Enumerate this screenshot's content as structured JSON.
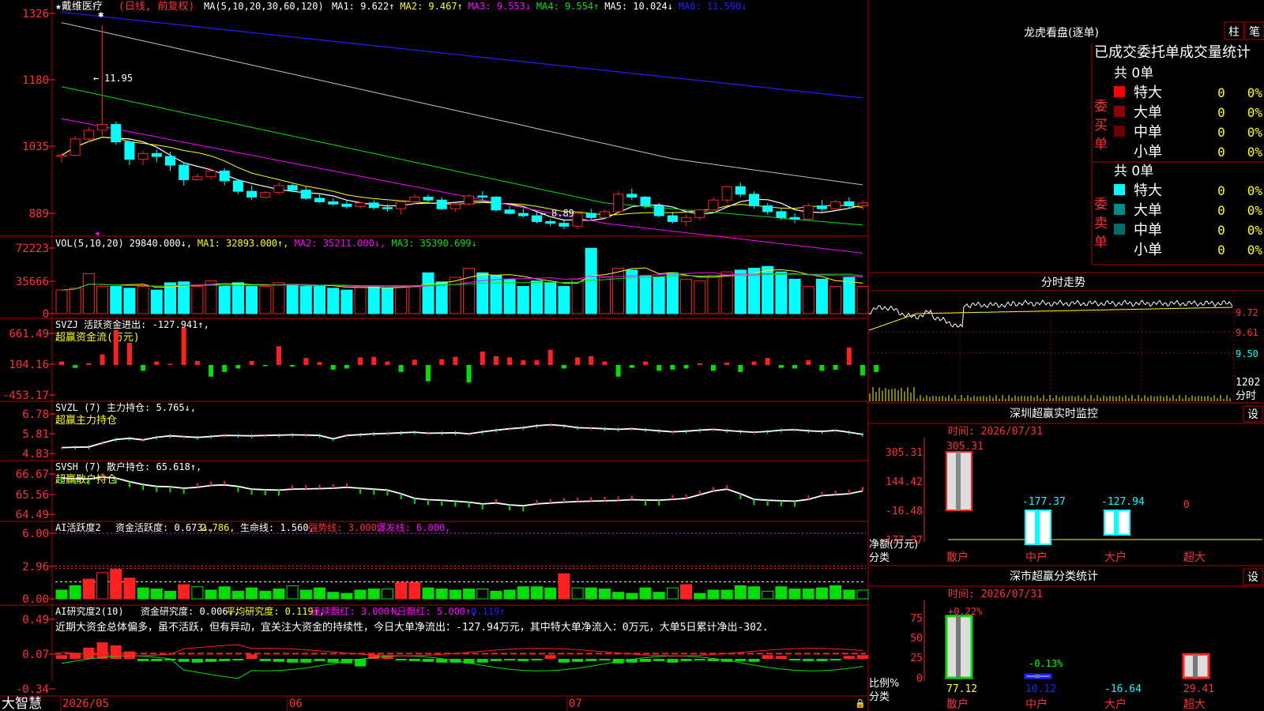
{
  "colors": {
    "up": "#ff2020",
    "down": "#00ffff",
    "green": "#00e000",
    "border": "#b00000",
    "ma1": "#ffffff",
    "ma2": "#ffff00",
    "ma3": "#ff00ff",
    "ma4": "#00e000",
    "ma5": "#c0c0c0",
    "ma6": "#2020ff",
    "text_white": "#ffffff",
    "text_yellow": "#ffff00",
    "text_red": "#ff3030",
    "text_cyan": "#00ffff",
    "text_green": "#00ff00",
    "text_magenta": "#ff00ff"
  },
  "app": {
    "brand": "大智慧"
  },
  "price_panel": {
    "title": "★戴维医疗",
    "mode": "(日线, 前复权)",
    "ma_params": "MA(5,10,20,30,60,120)",
    "ma_values": [
      {
        "text": "MA1: 9.622↑",
        "color": "#ffffff"
      },
      {
        "text": "MA2: 9.467↑",
        "color": "#ffff00"
      },
      {
        "text": "MA3: 9.553↓",
        "color": "#ff00ff"
      },
      {
        "text": "MA4: 9.554↑",
        "color": "#00e000"
      },
      {
        "text": "MA5: 10.024↓",
        "color": "#ffffff"
      },
      {
        "text": "MA6: 11.590↓",
        "color": "#2020ff"
      }
    ],
    "y_ticks": [
      "1326",
      "1180",
      "1035",
      "889"
    ],
    "high_marker": "11.95",
    "low_marker": "8.89"
  },
  "vol_panel": {
    "label": "VOL(5,10,20)",
    "values": [
      {
        "text": "29840.000↓,",
        "color": "#ffffff"
      },
      {
        "text": "MA1: 32893.000↑,",
        "color": "#ffff00"
      },
      {
        "text": "MA2: 35211.000↓,",
        "color": "#ff00ff"
      },
      {
        "text": "MA3: 35390.699↓",
        "color": "#00e000"
      }
    ],
    "y_ticks": [
      "72223",
      "35666",
      "0"
    ]
  },
  "svzj_panel": {
    "label": "SVZJ  活跃资金进出: -127.941↑,",
    "sub": "超赢资金流(万元)",
    "y_ticks": [
      "661.49",
      "104.16",
      "-453.17"
    ]
  },
  "svzl_panel": {
    "label": "SVZL  (7) 主力持仓: 5.765↓,",
    "sub": "超赢主力持仓",
    "y_ticks": [
      "6.78",
      "5.81",
      "4.83"
    ]
  },
  "svsh_panel": {
    "label": "SVSH  (7) 散户持仓: 65.618↑,",
    "sub": "超赢散户持仓",
    "y_ticks": [
      "66.67",
      "65.56",
      "64.49"
    ]
  },
  "ai_active_panel": {
    "label": "AI活跃度2",
    "values": [
      {
        "text": "资金活跃度: 0.673↓,",
        "color": "#ffffff"
      },
      {
        "text": "2.786,",
        "color": "#ffff00"
      },
      {
        "text": "生命线: 1.560,",
        "color": "#ffffff"
      },
      {
        "text": "强势线: 3.000,",
        "color": "#ff3030"
      },
      {
        "text": "爆发线: 6.000,",
        "color": "#ff00ff"
      }
    ],
    "y_ticks": [
      "6.00",
      "2.96",
      "0.00"
    ]
  },
  "ai_research_panel": {
    "label": "AI研究度2(10)",
    "values": [
      {
        "text": "资金研究度: 0.006↓,",
        "color": "#ffffff"
      },
      {
        "text": "平均研究度: 0.119↑,",
        "color": "#ffff00"
      },
      {
        "text": "连续飘红: 3.000↑,",
        "color": "#ff00ff"
      },
      {
        "text": "N日飘红: 5.000↑,",
        "color": "#ff00ff"
      },
      {
        "text": "0.119↑",
        "color": "#2020ff"
      }
    ],
    "comment": "近期大资金总体偏多，虽不活跃，但有异动，宜关注大资金的持续性，今日大单净流出：-127.94万元，其中特大单净流入：0万元，大单5日累计净出-302.",
    "y_ticks": [
      "0.49",
      "0.07",
      "-0.34"
    ]
  },
  "x_axis": {
    "labels": [
      "2026/05",
      "06",
      "07"
    ]
  },
  "dragon_tiger": {
    "title": "龙虎看盘(逐单)",
    "tabs": [
      "柱",
      "笔"
    ],
    "heading": "已成交委托单成交量统计",
    "buy": {
      "side_label": "委买单",
      "total": "共 0单",
      "rows": [
        {
          "label": "特大",
          "value": "0",
          "pct": "0%",
          "color": "#ff0000"
        },
        {
          "label": "大单",
          "value": "0",
          "pct": "0%",
          "color": "#8b0000"
        },
        {
          "label": "中单",
          "value": "0",
          "pct": "0%",
          "color": "#6b0000"
        },
        {
          "label": "小单",
          "value": "0",
          "pct": "0%",
          "color": "#000000"
        }
      ]
    },
    "sell": {
      "side_label": "委卖单",
      "total": "共 0单",
      "rows": [
        {
          "label": "特大",
          "value": "0",
          "pct": "0%",
          "color": "#00ffff"
        },
        {
          "label": "大单",
          "value": "0",
          "pct": "0%",
          "color": "#008b8b"
        },
        {
          "label": "中单",
          "value": "0",
          "pct": "0%",
          "color": "#006b6b"
        },
        {
          "label": "小单",
          "value": "0",
          "pct": "0%",
          "color": "#000000"
        }
      ]
    }
  },
  "intraday": {
    "title": "分时走势",
    "y_ticks": [
      "9.72",
      "9.61",
      "9.50"
    ],
    "vol_tick": "1202",
    "vol_unit": "分时"
  },
  "monitor": {
    "title": "深圳超赢实时监控",
    "settings": "设",
    "time": "时间: 2026/07/31",
    "y_ticks": [
      "305.31",
      "144.42",
      "-16.48",
      "-177.37"
    ],
    "unit_label": "净额(万元)",
    "cat_label": "分类",
    "categories": [
      "散户",
      "中户",
      "大户",
      "超大"
    ],
    "values": [
      "305.31",
      "-177.37",
      "-127.94",
      "0"
    ]
  },
  "classify": {
    "title": "深市超赢分类统计",
    "settings": "设",
    "time": "时间: 2026/07/31",
    "y_ticks": [
      "75",
      "50",
      "25",
      "0"
    ],
    "unit_label": "比例%",
    "cat_label": "分类",
    "categories": [
      "散户",
      "中户",
      "大户",
      "超大"
    ],
    "values": [
      "77.12",
      "10.12",
      "-16.64",
      "29.41"
    ],
    "top_labels": [
      "+0.22%",
      "-0.13%"
    ]
  },
  "chart_data": [
    {
      "type": "candlestick",
      "title": "戴维医疗 (日线, 前复权)",
      "note": "candle OHLC estimated from axis ticks 889/1035/1180/1326",
      "candles": [
        [
          9.7,
          9.75,
          9.6,
          9.72
        ],
        [
          9.72,
          10.05,
          9.7,
          10.0
        ],
        [
          10.0,
          10.2,
          9.95,
          10.15
        ],
        [
          10.15,
          11.95,
          10.05,
          10.25
        ],
        [
          10.25,
          10.3,
          9.9,
          9.95
        ],
        [
          9.95,
          10.0,
          9.55,
          9.65
        ],
        [
          9.65,
          9.8,
          9.55,
          9.75
        ],
        [
          9.75,
          9.82,
          9.6,
          9.7
        ],
        [
          9.7,
          9.78,
          9.45,
          9.55
        ],
        [
          9.55,
          9.6,
          9.2,
          9.3
        ],
        [
          9.3,
          9.4,
          9.28,
          9.35
        ],
        [
          9.35,
          9.5,
          9.3,
          9.45
        ],
        [
          9.45,
          9.5,
          9.2,
          9.28
        ],
        [
          9.28,
          9.3,
          9.05,
          9.1
        ],
        [
          9.1,
          9.2,
          8.95,
          9.0
        ],
        [
          9.0,
          9.1,
          8.98,
          9.08
        ],
        [
          9.08,
          9.25,
          9.05,
          9.2
        ],
        [
          9.2,
          9.25,
          9.1,
          9.12
        ],
        [
          9.12,
          9.18,
          8.95,
          8.98
        ],
        [
          8.98,
          9.05,
          8.9,
          8.92
        ],
        [
          8.92,
          8.98,
          8.85,
          8.88
        ],
        [
          8.88,
          8.95,
          8.8,
          8.84
        ],
        [
          8.84,
          8.92,
          8.8,
          8.9
        ],
        [
          8.9,
          8.95,
          8.78,
          8.82
        ],
        [
          8.82,
          8.88,
          8.75,
          8.8
        ],
        [
          8.8,
          8.95,
          8.7,
          8.92
        ],
        [
          8.92,
          9.05,
          8.88,
          9.0
        ],
        [
          9.0,
          9.05,
          8.9,
          8.95
        ],
        [
          8.95,
          9.0,
          8.78,
          8.8
        ],
        [
          8.8,
          8.9,
          8.75,
          8.88
        ],
        [
          8.88,
          9.05,
          8.85,
          9.02
        ],
        [
          9.02,
          9.1,
          8.95,
          9.0
        ],
        [
          9.0,
          9.02,
          8.75,
          8.78
        ],
        [
          8.78,
          8.85,
          8.7,
          8.72
        ],
        [
          8.72,
          8.8,
          8.65,
          8.68
        ],
        [
          8.68,
          8.75,
          8.55,
          8.58
        ],
        [
          8.58,
          8.62,
          8.5,
          8.55
        ],
        [
          8.55,
          8.6,
          8.45,
          8.5
        ],
        [
          8.5,
          8.75,
          8.45,
          8.72
        ],
        [
          8.72,
          8.8,
          8.6,
          8.65
        ],
        [
          8.65,
          8.78,
          8.62,
          8.75
        ],
        [
          8.75,
          9.1,
          8.72,
          9.05
        ],
        [
          9.05,
          9.15,
          8.95,
          9.0
        ],
        [
          9.0,
          9.02,
          8.8,
          8.85
        ],
        [
          8.85,
          8.9,
          8.65,
          8.68
        ],
        [
          8.68,
          8.75,
          8.55,
          8.58
        ],
        [
          8.58,
          8.7,
          8.5,
          8.65
        ],
        [
          8.65,
          8.8,
          8.6,
          8.78
        ],
        [
          8.78,
          9.0,
          8.75,
          8.95
        ],
        [
          8.95,
          9.2,
          8.9,
          9.18
        ],
        [
          9.18,
          9.25,
          9.0,
          9.05
        ],
        [
          9.05,
          9.1,
          8.8,
          8.85
        ],
        [
          8.85,
          8.9,
          8.7,
          8.75
        ],
        [
          8.75,
          8.82,
          8.6,
          8.65
        ],
        [
          8.65,
          8.72,
          8.55,
          8.62
        ],
        [
          8.62,
          8.9,
          8.6,
          8.85
        ],
        [
          8.85,
          8.95,
          8.75,
          8.8
        ],
        [
          8.8,
          8.95,
          8.78,
          8.92
        ],
        [
          8.92,
          9.0,
          8.8,
          8.85
        ],
        [
          8.85,
          8.95,
          8.78,
          8.9
        ]
      ]
    },
    {
      "type": "bar",
      "title": "VOL(5,10,20)",
      "values": [
        26000,
        28000,
        44000,
        30000,
        30000,
        28000,
        30000,
        26000,
        34000,
        35000,
        30000,
        36000,
        30000,
        34000,
        30000,
        30000,
        34000,
        32000,
        30000,
        30000,
        28000,
        26000,
        30000,
        30000,
        28000,
        30000,
        30000,
        45000,
        35000,
        40000,
        50000,
        45000,
        42000,
        38000,
        30000,
        36000,
        34000,
        30000,
        38000,
        72000,
        40000,
        50000,
        48000,
        42000,
        40000,
        45000,
        38000,
        36000,
        42000,
        46000,
        48000,
        50000,
        52000,
        46000,
        38000,
        30000,
        38000,
        30000,
        40000,
        30000
      ]
    },
    {
      "type": "bar",
      "title": "SVZJ 活跃资金进出",
      "values": [
        60,
        -50,
        30,
        180,
        600,
        380,
        -100,
        60,
        20,
        640,
        70,
        -200,
        -120,
        -60,
        70,
        -20,
        320,
        -30,
        120,
        50,
        -80,
        -60,
        130,
        140,
        60,
        -120,
        90,
        -280,
        100,
        140,
        -300,
        230,
        150,
        130,
        80,
        80,
        260,
        -60,
        130,
        150,
        60,
        -200,
        -50,
        60,
        -100,
        -80,
        -60,
        30,
        -100,
        40,
        -120,
        60,
        120,
        -50,
        -60,
        80,
        -100,
        -80,
        300,
        -180,
        -120
      ]
    },
    {
      "type": "line",
      "title": "SVZL 主力持仓",
      "values": [
        5.12,
        5.14,
        5.15,
        5.35,
        5.52,
        5.58,
        5.5,
        5.63,
        5.7,
        5.66,
        5.62,
        5.67,
        5.72,
        5.71,
        5.7,
        5.72,
        5.73,
        5.75,
        5.74,
        5.72,
        5.55,
        5.72,
        5.76,
        5.8,
        5.82,
        5.85,
        5.88,
        5.83,
        5.84,
        5.85,
        5.8,
        5.9,
        5.98,
        6.05,
        6.1,
        6.2,
        6.25,
        6.2,
        6.1,
        6.08,
        6.05,
        6.02,
        6.05,
        6.0,
        5.95,
        5.9,
        5.93,
        5.98,
        6.02,
        5.96,
        5.92,
        5.88,
        5.92,
        5.98,
        6.0,
        5.95,
        5.92,
        5.97,
        5.88,
        5.77
      ]
    },
    {
      "type": "line",
      "title": "SVSH 散户持仓",
      "values": [
        66.45,
        66.42,
        66.4,
        66.5,
        66.45,
        66.25,
        66.1,
        66.0,
        65.98,
        65.9,
        65.95,
        66.05,
        66.08,
        66.0,
        65.85,
        65.82,
        65.8,
        65.85,
        65.86,
        65.88,
        65.9,
        65.95,
        65.9,
        65.85,
        65.8,
        65.6,
        65.35,
        65.28,
        65.25,
        65.2,
        65.15,
        65.05,
        65.1,
        65.0,
        64.95,
        65.05,
        65.1,
        65.15,
        65.18,
        65.2,
        65.22,
        65.24,
        65.28,
        65.26,
        65.25,
        65.3,
        65.35,
        65.55,
        65.75,
        65.85,
        65.6,
        65.3,
        65.25,
        65.22,
        65.2,
        65.3,
        65.5,
        65.55,
        65.6,
        65.75
      ]
    },
    {
      "type": "bar",
      "title": "AI活跃度2",
      "values": [
        0.8,
        1.2,
        1.8,
        2.4,
        2.7,
        1.9,
        1.0,
        0.9,
        0.7,
        1.3,
        1.1,
        0.8,
        1.1,
        0.7,
        1.0,
        0.7,
        0.9,
        1.2,
        0.8,
        1.0,
        0.6,
        0.5,
        0.8,
        0.9,
        0.9,
        1.5,
        1.5,
        1.0,
        0.9,
        0.8,
        0.9,
        0.9,
        0.7,
        0.8,
        1.1,
        1.1,
        1.0,
        2.3,
        1.0,
        1.0,
        0.9,
        0.6,
        0.5,
        1.0,
        0.6,
        1.0,
        1.3,
        0.5,
        0.8,
        0.8,
        1.2,
        1.1,
        0.7,
        1.1,
        0.9,
        0.9,
        1.0,
        1.2,
        0.8,
        0.8
      ]
    },
    {
      "type": "bar",
      "title": "AI研究度2(10)",
      "values": [
        0.05,
        0.08,
        0.15,
        0.22,
        0.18,
        0.1,
        -0.03,
        -0.03,
        -0.02,
        -0.04,
        -0.05,
        -0.04,
        -0.03,
        -0.02,
        0.06,
        -0.03,
        -0.04,
        -0.05,
        -0.05,
        -0.03,
        -0.05,
        -0.06,
        -0.1,
        0.06,
        0.05,
        -0.02,
        -0.03,
        -0.04,
        -0.05,
        -0.05,
        -0.06,
        -0.05,
        -0.03,
        -0.02,
        -0.03,
        -0.02,
        0.05,
        -0.05,
        -0.04,
        -0.03,
        -0.02,
        -0.06,
        -0.05,
        -0.04,
        -0.03,
        -0.05,
        -0.03,
        -0.02,
        -0.03,
        -0.04,
        -0.03,
        -0.04,
        0.05,
        0.04,
        -0.02,
        -0.03,
        -0.03,
        -0.02,
        0.04,
        0.05
      ]
    },
    {
      "type": "bar",
      "title": "深圳超赢实时监控",
      "categories": [
        "散户",
        "中户",
        "大户",
        "超大"
      ],
      "values": [
        305.31,
        -177.37,
        -127.94,
        0
      ]
    },
    {
      "type": "bar",
      "title": "深市超赢分类统计",
      "categories": [
        "散户",
        "中户",
        "大户",
        "超大"
      ],
      "values": [
        77.12,
        10.12,
        -16.64,
        29.41
      ]
    }
  ]
}
